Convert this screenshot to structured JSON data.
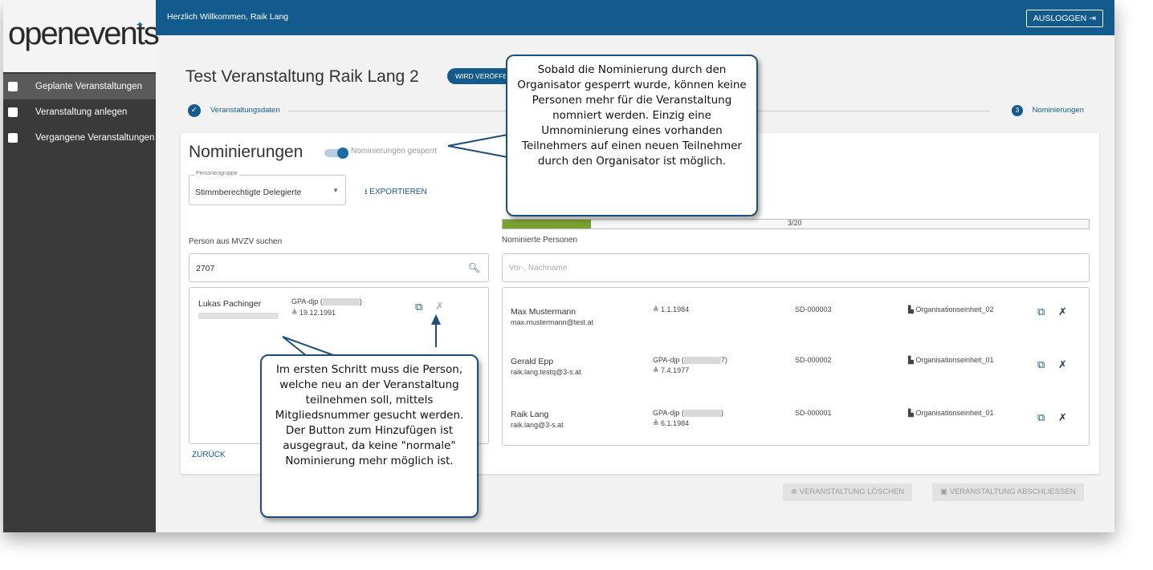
{
  "brand": {
    "logo_text": "openevents"
  },
  "sidebar": {
    "items": [
      {
        "label": "Geplante Veranstaltungen",
        "icon": "calendar-icon",
        "active": true
      },
      {
        "label": "Veranstaltung anlegen",
        "icon": "plus-box-icon",
        "active": false
      },
      {
        "label": "Vergangene Veranstaltungen",
        "icon": "calendar-clock-icon",
        "active": false
      }
    ]
  },
  "header": {
    "welcome": "Herzlich Willkommen, Raik Lang",
    "logout_label": "AUSLOGGEN"
  },
  "page": {
    "title": "Test Veranstaltung Raik Lang 2",
    "status_chip": "WIRD VERÖFFENTLICHT"
  },
  "stepper": {
    "step1_label": "Veranstaltungsdaten",
    "step3_number": "3",
    "step3_label": "Nominierungen"
  },
  "nominations": {
    "title": "Nominierungen",
    "toggle_label": "Nominierungen gesperrt",
    "group_select": {
      "label": "Personengruppe",
      "value": "Stimmberechtigte Delegierte"
    },
    "export_label": "EXPORTIEREN",
    "progress": {
      "text": "3/20",
      "fraction": 0.15
    },
    "search_label": "Person aus MVZV suchen",
    "search_value": "2707",
    "nominated_label": "Nominierte Personen",
    "nominated_placeholder": "Vor-, Nachname",
    "back_label": "ZURÜCK"
  },
  "search_result": {
    "name": "Lukas Pachinger",
    "org_prefix": "GPA-djp (",
    "org_suffix": ")",
    "birthdate": "19.12.1991"
  },
  "nominated": [
    {
      "name": "Max Mustermann",
      "email": "max.mustermann@test.at",
      "org_prefix": "",
      "org_suffix": "",
      "birthdate": "1.1.1984",
      "id": "SD-000003",
      "unit": "Organisationseinheit_02"
    },
    {
      "name": "Gerald Epp",
      "email": "raik.lang.testq@3-s.at",
      "org_prefix": "GPA-djp (",
      "org_suffix": "7)",
      "birthdate": "7.4.1977",
      "id": "SD-000002",
      "unit": "Organisationseinheit_01"
    },
    {
      "name": "Raik Lang",
      "email": "raik.lang@3-s.at",
      "org_prefix": "GPA-djp (",
      "org_suffix": ")",
      "birthdate": "6.1.1984",
      "id": "SD-000001",
      "unit": "Organisationseinheit_01"
    }
  ],
  "footer_buttons": {
    "delete_label": "VERANSTALTUNG LÖSCHEN",
    "close_label": "VERANSTALTUNG ABSCHLIESSEN"
  },
  "callouts": {
    "top": "Sobald die Nominierung durch den Organisator gesperrt wurde, können keine Personen mehr für die Veranstaltung nomniert werden. Einzig eine Umnominierung eines vorhanden Teilnehmers auf einen neuen Teilnehmer durch den Organisator ist möglich.",
    "bottom": "Im ersten Schritt muss die Person, welche neu an der Veranstaltung teilnehmen soll, mittels Mitgliedsnummer gesucht werden. Der Button zum Hinzufügen ist ausgegraut, da keine \"normale\" Nominierung mehr möglich ist."
  },
  "colors": {
    "primary": "#135b8c",
    "sidebar": "#3a3a3a",
    "progress": "#78a22f",
    "callout_border": "#1d4f7a"
  }
}
